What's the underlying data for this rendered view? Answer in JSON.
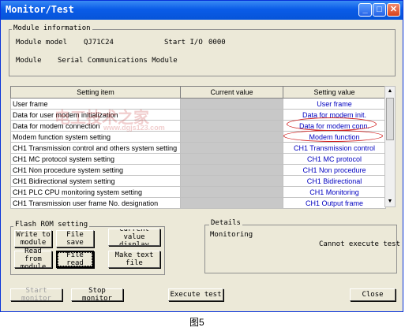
{
  "window": {
    "title": "Monitor/Test"
  },
  "module_info": {
    "group_label": "Module information",
    "model_label": "Module model",
    "model_value": "QJ71C24",
    "start_io_label": "Start I/O",
    "start_io_value": "0000",
    "module_label": "Module",
    "module_value": "Serial Communications Module"
  },
  "table": {
    "headers": [
      "Setting item",
      "Current value",
      "Setting value"
    ],
    "rows": [
      {
        "item": "User frame",
        "current": "",
        "setting": "User frame"
      },
      {
        "item": "Data for user modem initialization",
        "current": "",
        "setting": "Data for modem init."
      },
      {
        "item": "Data for modem connection",
        "current": "",
        "setting": "Data for modem conn."
      },
      {
        "item": "Modem function system setting",
        "current": "",
        "setting": "Modem function"
      },
      {
        "item": "CH1 Transmission control and others system setting",
        "current": "",
        "setting": "CH1 Transmission control"
      },
      {
        "item": "CH1 MC protocol system setting",
        "current": "",
        "setting": "CH1 MC protocol"
      },
      {
        "item": "CH1 Non procedure system setting",
        "current": "",
        "setting": "CH1 Non procedure"
      },
      {
        "item": "CH1 Bidirectional system setting",
        "current": "",
        "setting": "CH1 Bidirectional"
      },
      {
        "item": "CH1 PLC CPU monitoring system setting",
        "current": "",
        "setting": "CH1 Monitoring"
      },
      {
        "item": "CH1 Transmission user frame No. designation",
        "current": "",
        "setting": "CH1 Output frame"
      }
    ]
  },
  "flash": {
    "group_label": "Flash ROM setting",
    "write_button": "Write to module",
    "file_save_button": "File save",
    "current_value_button": "Current value display",
    "read_button": "Read from module",
    "file_read_button": "File read",
    "make_text_button": "Make text file"
  },
  "details": {
    "group_label": "Details",
    "status_label": "Monitoring",
    "message": "Cannot execute test"
  },
  "bottom": {
    "start_monitor": "Start monitor",
    "stop_monitor": "Stop monitor",
    "execute_test": "Execute test",
    "close": "Close"
  },
  "caption": "图5",
  "watermark": {
    "main": "电工技术之家",
    "url": "www.dgjs123.com"
  },
  "colors": {
    "title_bar": "#0a5ce8",
    "highlight": "#d02020",
    "setting_link": "#0000c0"
  }
}
